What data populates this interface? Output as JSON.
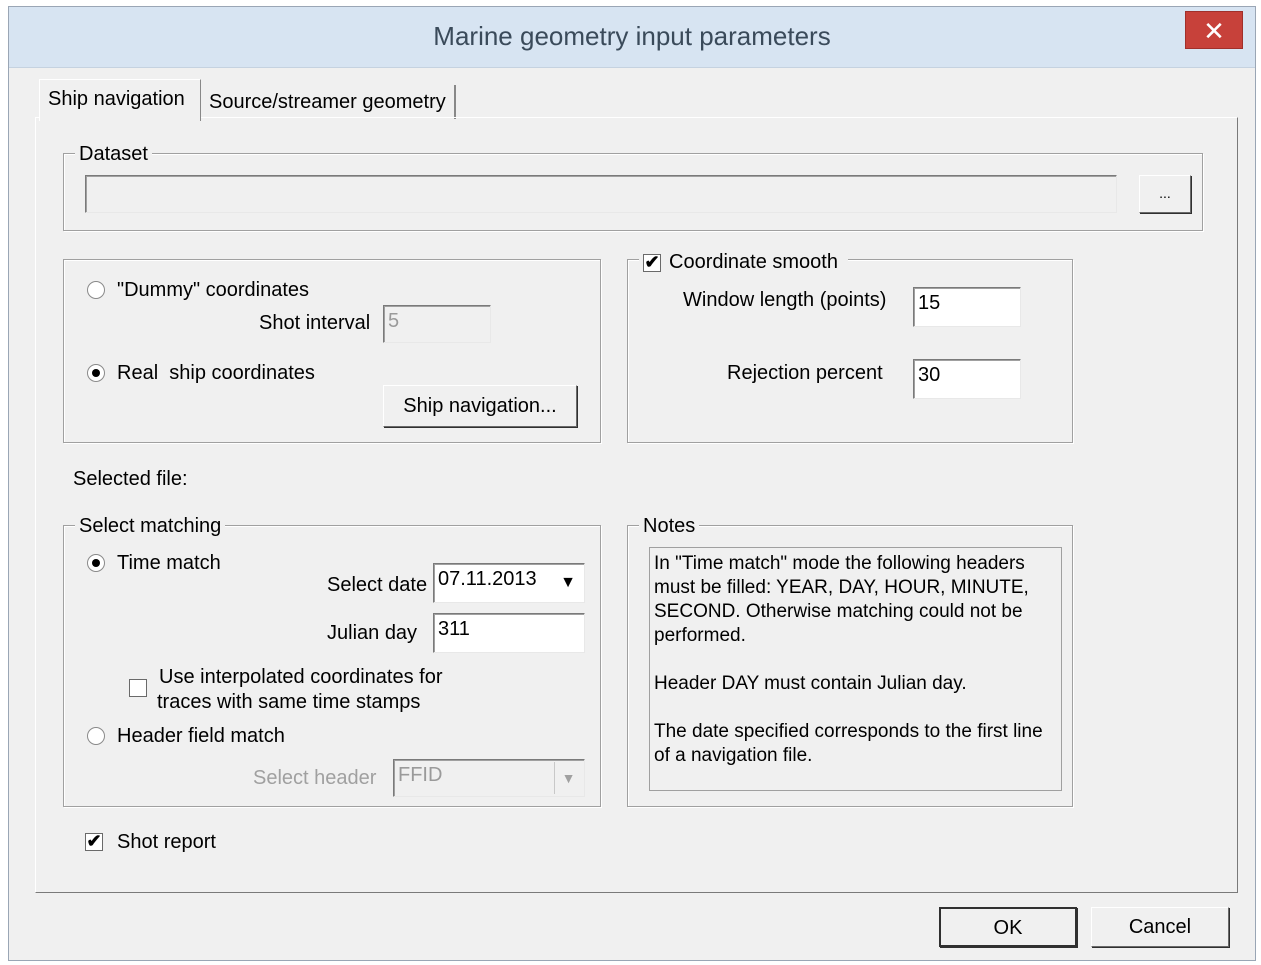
{
  "window": {
    "title": "Marine geometry input parameters",
    "close_glyph": "✕"
  },
  "tabs": [
    {
      "label": "Ship navigation",
      "active": true
    },
    {
      "label": "Source/streamer geometry",
      "active": false
    }
  ],
  "dataset": {
    "legend": "Dataset",
    "value": "",
    "browse_label": "..."
  },
  "coord_source": {
    "dummy_label": "\"Dummy\" coordinates",
    "shot_interval_label": "Shot interval",
    "shot_interval_value": "5",
    "real_label": "Real  ship coordinates",
    "selected": "real",
    "ship_nav_button": "Ship navigation..."
  },
  "smooth": {
    "legend": "Coordinate smooth",
    "checked": true,
    "window_label": "Window length (points)",
    "window_value": "15",
    "rejection_label": "Rejection percent",
    "rejection_value": "30"
  },
  "selected_file_label": "Selected file:",
  "matching": {
    "legend": "Select matching",
    "time_match_label": "Time match",
    "selected": "time",
    "select_date_label": "Select date",
    "select_date_value": "07.11.2013",
    "julian_day_label": "Julian day",
    "julian_day_value": "311",
    "interp_label_1": "Use interpolated coordinates for",
    "interp_label_2": "traces with same time stamps",
    "interp_checked": false,
    "header_match_label": "Header field match",
    "select_header_label": "Select header",
    "select_header_value": "FFID"
  },
  "notes": {
    "legend": "Notes",
    "p1": "In \"Time match\" mode the following headers must be filled: YEAR, DAY, HOUR, MINUTE, SECOND. Otherwise matching could not be performed.",
    "p2": "Header DAY must contain Julian day.",
    "p3": "The date specified corresponds to the first line of a navigation file."
  },
  "shot_report": {
    "label": "Shot report",
    "checked": true
  },
  "buttons": {
    "ok": "OK",
    "cancel": "Cancel"
  },
  "icons": {
    "checkmark": "✔",
    "dropdown": "▼"
  }
}
